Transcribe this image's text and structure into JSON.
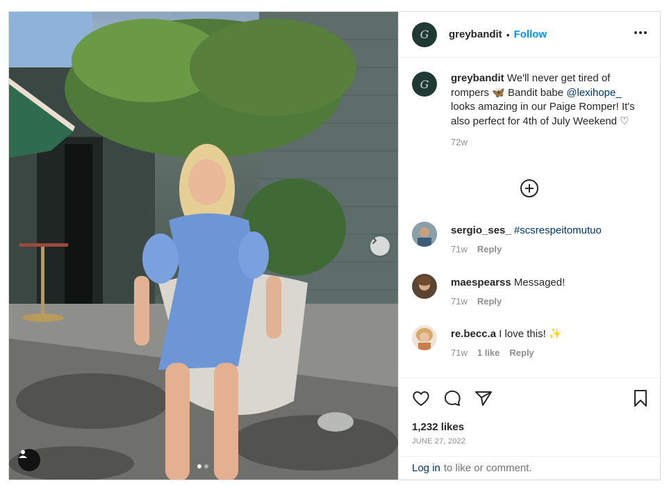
{
  "post": {
    "author": "greybandit",
    "author_initials": "G",
    "follow_label": "Follow",
    "separator": "•",
    "caption": {
      "username": "greybandit",
      "text_1": "We'll never get tired of rompers 🦋 Bandit babe",
      "mention": "@lexihope_",
      "text_2": "looks amazing in our Paige Romper! It's also perfect for 4th of July Weekend ♡",
      "age": "72w"
    },
    "comments": [
      {
        "username": "sergio_ses_",
        "text": "",
        "hashtag": "#scsrespeitomutuo",
        "age": "71w",
        "likes": "",
        "reply_label": "Reply",
        "avatar_color": "#6f7f8a"
      },
      {
        "username": "maespearss",
        "text": "Messaged!",
        "hashtag": "",
        "age": "71w",
        "likes": "",
        "reply_label": "Reply",
        "avatar_color": "#7a5a3e"
      },
      {
        "username": "re.becc.a",
        "text": "I love this! ✨",
        "hashtag": "",
        "age": "71w",
        "likes": "1 like",
        "reply_label": "Reply",
        "avatar_color": "#c89a6c"
      }
    ],
    "likes_count": "1,232 likes",
    "date": "JUNE 27, 2022",
    "login_bar": {
      "link": "Log in",
      "rest": "to like or comment."
    },
    "carousel": {
      "total": 2,
      "active": 1
    },
    "icons": {
      "like": "heart-icon",
      "comment": "comment-icon",
      "share": "send-icon",
      "save": "bookmark-icon",
      "more": "more-options-icon",
      "load_more": "plus-circle-icon",
      "next": "chevron-right-icon",
      "tags": "user-tag-icon"
    },
    "colors": {
      "link": "#0095f6",
      "mention": "#00376b",
      "muted": "#8e8e8e",
      "brand_avatar": "#1f3a32"
    }
  }
}
